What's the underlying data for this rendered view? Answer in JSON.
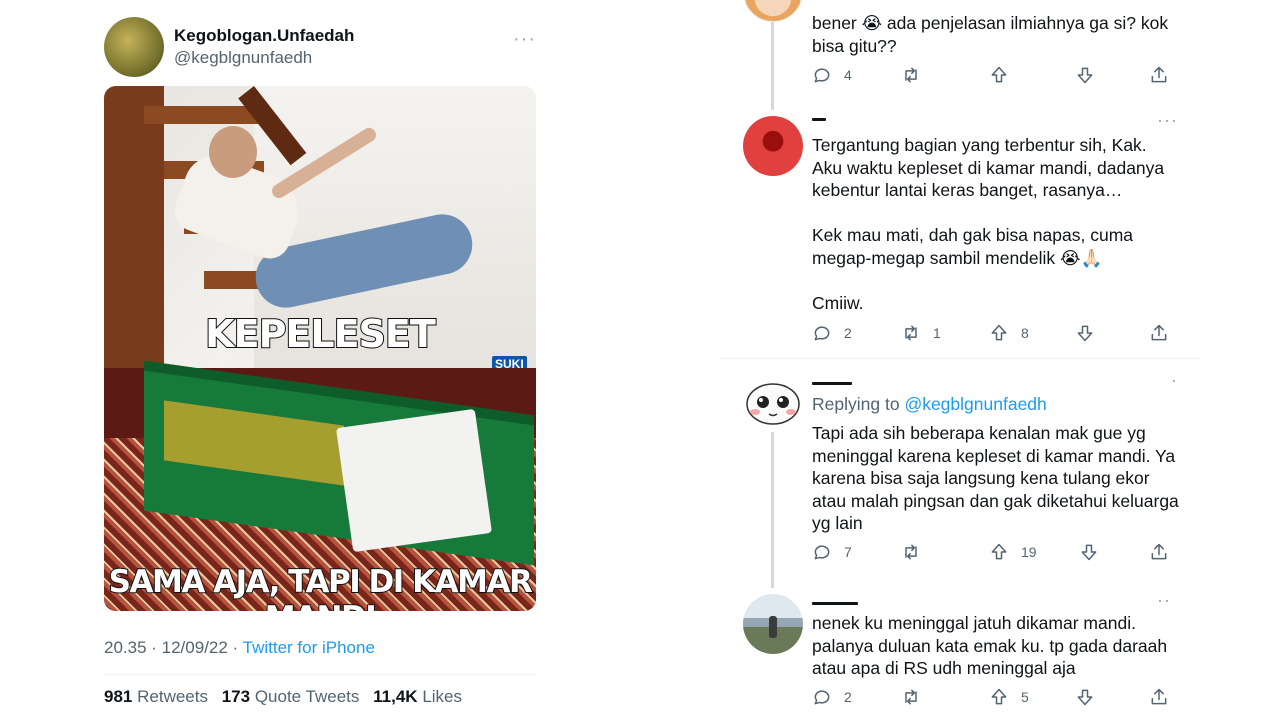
{
  "tweet": {
    "display_name": "Kegoblogan.Unfaedah",
    "handle": "@kegblgnunfaedh",
    "more_glyph": "···",
    "meme": {
      "top_caption": "KEPELESET",
      "bottom_caption": "SAMA AJA, TAPI DI KAMAR MANDI",
      "watermark": "SUKI"
    },
    "time": "20.35 · 12/09/22 ·",
    "source": "Twitter for iPhone",
    "stats": {
      "retweets_count": "981",
      "retweets_label": "Retweets",
      "quotes_count": "173",
      "quotes_label": "Quote Tweets",
      "likes_count": "11,4K",
      "likes_label": "Likes"
    }
  },
  "replies": [
    {
      "text": "bener 😭 ada penjelasan ilmiahnya ga si? kok bisa gitu??",
      "reply_count": "4",
      "retweet_count": "",
      "upvote_count": ""
    },
    {
      "text_lines": [
        "Tergantung bagian yang terbentur sih, Kak.",
        "Aku waktu kepleset di kamar mandi, dadanya",
        "kebentur lantai keras banget, rasanya…",
        "",
        "Kek mau mati, dah gak bisa napas, cuma",
        "megap-megap sambil mendelik 😭🙏🏻",
        "",
        "Cmiiw."
      ],
      "reply_count": "2",
      "retweet_count": "1",
      "upvote_count": "8"
    },
    {
      "replying_prefix": "Replying to",
      "replying_mention": "@kegblgnunfaedh",
      "text": "Tapi ada sih beberapa kenalan mak gue yg meninggal karena kepleset di kamar mandi. Ya karena bisa saja langsung kena tulang ekor atau malah pingsan dan gak diketahui keluarga yg lain",
      "reply_count": "7",
      "retweet_count": "",
      "upvote_count": "19"
    },
    {
      "text": "nenek ku meninggal jatuh dikamar mandi. palanya duluan kata emak ku. tp gada daraah atau apa di RS udh meninggal aja",
      "reply_count": "2",
      "retweet_count": "",
      "upvote_count": "5"
    }
  ],
  "icons": [
    "reply-icon",
    "retweet-icon",
    "upvote-icon",
    "downvote-icon",
    "share-icon"
  ],
  "colors": {
    "link": "#1d9bf0",
    "muted": "#536471",
    "text": "#0f1419"
  }
}
